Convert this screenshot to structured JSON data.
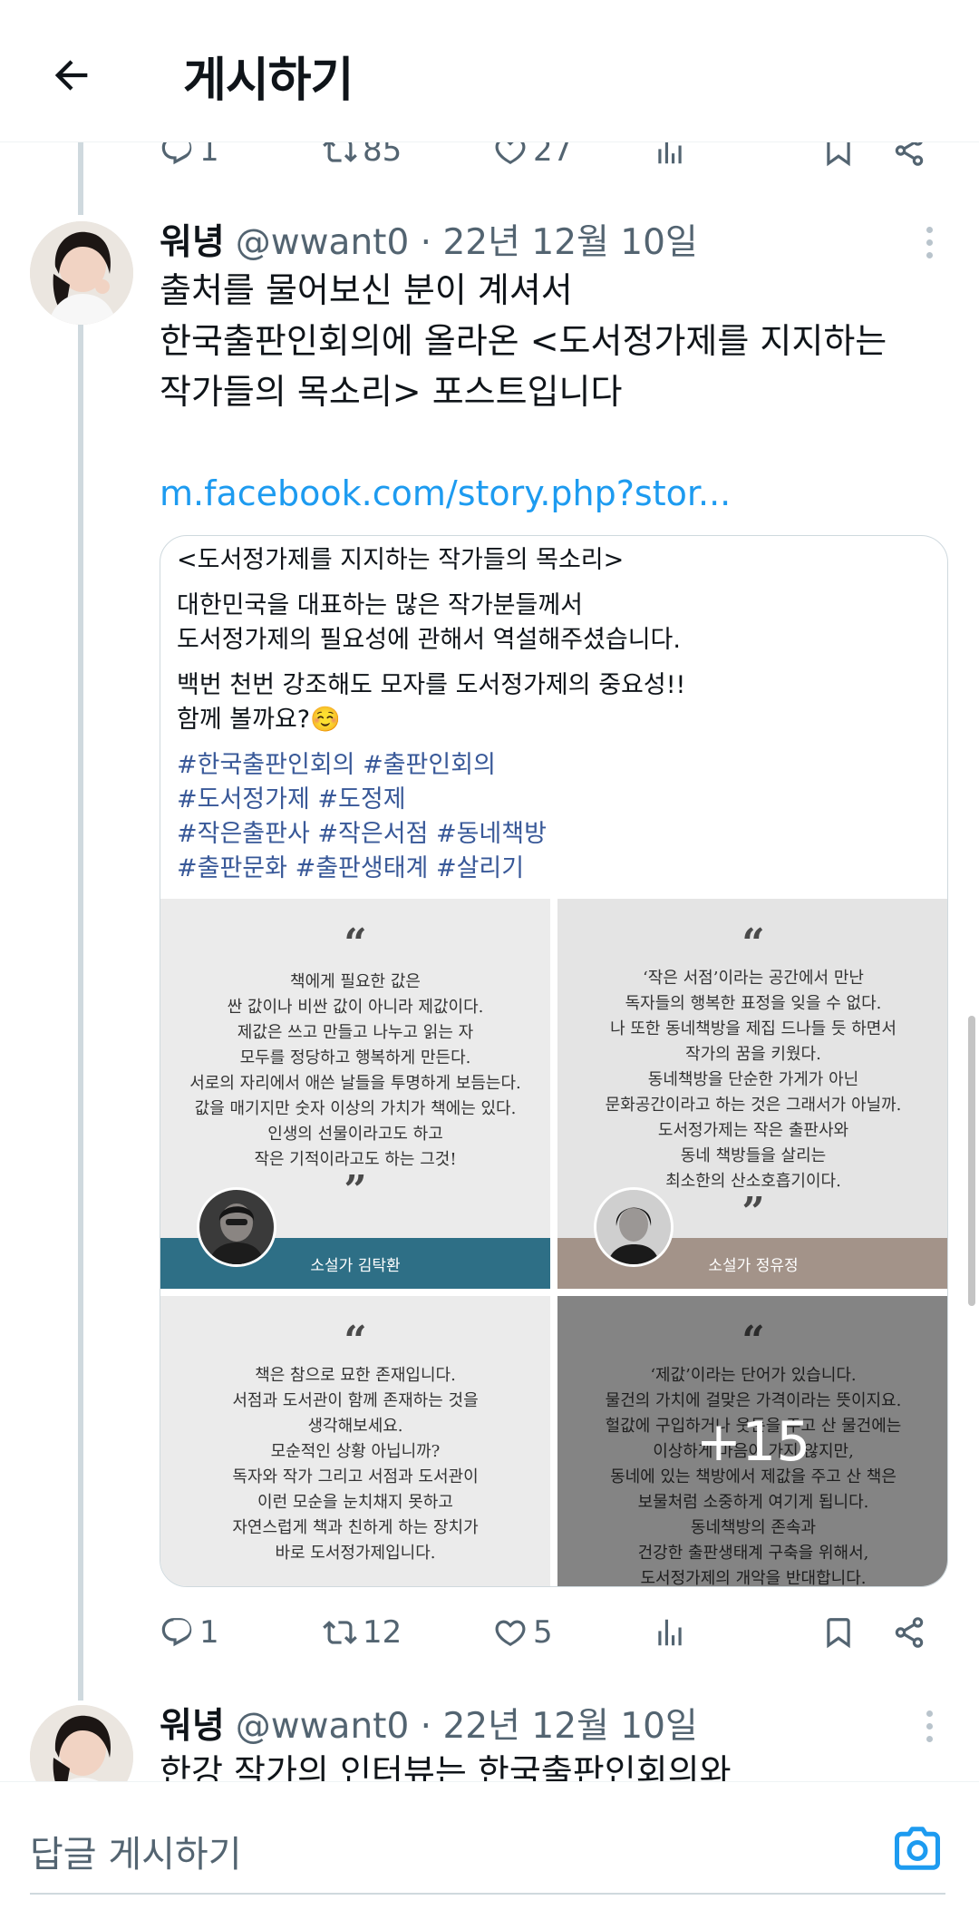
{
  "header": {
    "title": "게시하기"
  },
  "top_actions": {
    "replies": "1",
    "retweets": "85",
    "likes": "27"
  },
  "tweet1": {
    "name": "워녕",
    "handle": "@wwant0 · 22년 12월 10일",
    "lines": [
      "출처를 물어보신 분이 계셔서",
      "한국출판인회의에 올라온 <도서정가제를 지지하는",
      "작가들의 목소리> 포스트입니다"
    ],
    "link": "m.facebook.com/story.php?stor...",
    "media": {
      "caption_title": "<도서정가제를 지지하는 작가들의 목소리>",
      "caption_p1_l1": "대한민국을 대표하는 많은 작가분들께서",
      "caption_p1_l2": "도서정가제의 필요성에 관해서 역설해주셨습니다.",
      "caption_p2_l1": "백번 천번 강조해도 모자를 도서정가제의 중요성!!",
      "caption_p2_l2": "함께 볼까요?☺️",
      "tags_l1": "#한국출판인회의 #출판인회의",
      "tags_l2": "#도서정가제 #도정제",
      "tags_l3": "#작은출판사 #작은서점 #동네책방",
      "tags_l4": "#출판문화 #출판생태계 #살리기",
      "quote_open": "“",
      "quote_close": "”",
      "card1": {
        "lines": [
          "책에게 필요한 값은",
          "싼 값이나 비싼 값이 아니라 제값이다.",
          "제값은 쓰고 만들고 나누고 읽는 자",
          "모두를 정당하고 행복하게 만든다.",
          "서로의 자리에서 애쓴 날들을 투명하게 보듬는다.",
          "값을 매기지만 숫자 이상의 가치가 책에는 있다.",
          "인생의 선물이라고도 하고",
          "작은 기적이라고도 하는 그것!"
        ],
        "author": "소설가 김탁환",
        "footer_color": "#2e6f86"
      },
      "card2": {
        "lines": [
          "‘작은 서점’이라는 공간에서 만난",
          "독자들의 행복한 표정을 잊을 수 없다.",
          "나 또한 동네책방을 제집 드나들 듯 하면서",
          "작가의 꿈을 키웠다.",
          "동네책방을 단순한 가게가 아닌",
          "문화공간이라고 하는 것은 그래서가 아닐까.",
          "도서정가제는 작은 출판사와",
          "동네 책방들을 살리는",
          "최소한의 산소호흡기이다."
        ],
        "author": "소설가 정유정",
        "footer_color": "#a39389"
      },
      "card3": {
        "lines": [
          "책은 참으로 묘한 존재입니다.",
          "서점과 도서관이 함께 존재하는 것을",
          "생각해보세요.",
          "모순적인 상황 아닙니까?",
          "독자와 작가 그리고 서점과 도서관이",
          "이런 모순을 눈치채지 못하고",
          "자연스럽게 책과 친하게 하는 장치가",
          "바로 도서정가제입니다."
        ]
      },
      "card4": {
        "lines": [
          "‘제값’이라는 단어가 있습니다.",
          "물건의 가치에 걸맞은 가격이라는 뜻이지요.",
          "헐값에 구입하거나 웃돈을 주고 산 물건에는",
          "이상하게 마음이 가지 않지만,",
          "동네에 있는 책방에서 제값을 주고 산 책은",
          "보물처럼 소중하게 여기게 됩니다.",
          "동네책방의 존속과",
          "건강한 출판생태계 구축을 위해서,",
          "도서정가제의 개악을 반대합니다."
        ],
        "more_count": "+15"
      }
    },
    "actions": {
      "replies": "1",
      "retweets": "12",
      "likes": "5"
    }
  },
  "tweet2": {
    "name": "워녕",
    "handle": "@wwant0 · 22년 12월 10일",
    "text": "한강 작가의 인터뷰는 한국출판인회의와"
  },
  "reply_bar": {
    "placeholder": "답글 게시하기"
  },
  "colors": {
    "accent": "#1d9bf0",
    "muted": "#536471"
  }
}
